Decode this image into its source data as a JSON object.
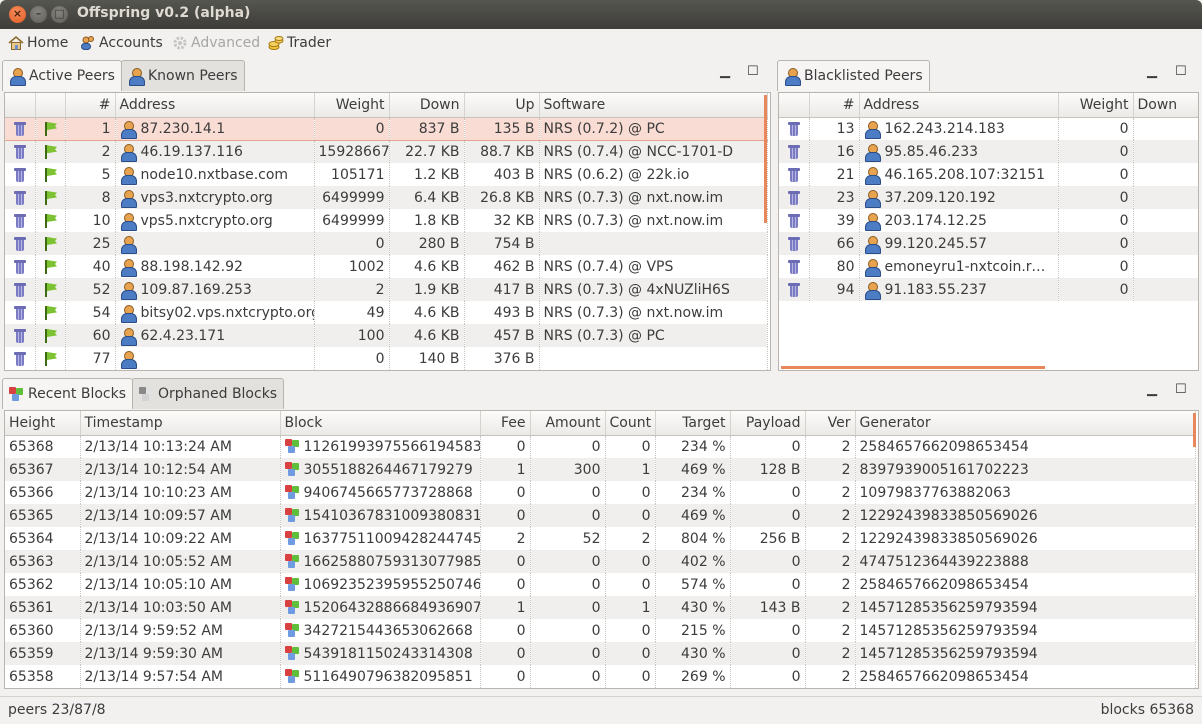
{
  "window": {
    "title": "Offspring v0.2 (alpha)"
  },
  "menu": {
    "home": "Home",
    "accounts": "Accounts",
    "advanced": "Advanced",
    "trader": "Trader"
  },
  "peers_tabs": {
    "active": "Active Peers",
    "known": "Known Peers"
  },
  "blacklist_tabs": {
    "blacklisted": "Blacklisted Peers"
  },
  "blocks_tabs": {
    "recent": "Recent Blocks",
    "orphaned": "Orphaned Blocks"
  },
  "panel_controls": {
    "minimize": "▁",
    "maximize": "☐"
  },
  "peers_table": {
    "columns": [
      "#",
      "Address",
      "Weight",
      "Down",
      "Up",
      "Software"
    ],
    "rows": [
      [
        "1",
        "87.230.14.1",
        "0",
        "837 B",
        "135 B",
        "NRS (0.7.2) @ PC"
      ],
      [
        "2",
        "46.19.137.116",
        "15928667",
        "22.7 KB",
        "88.7 KB",
        "NRS (0.7.4) @ NCC-1701-D"
      ],
      [
        "5",
        "node10.nxtbase.com",
        "105171",
        "1.2 KB",
        "403 B",
        "NRS (0.6.2) @ 22k.io"
      ],
      [
        "8",
        "vps3.nxtcrypto.org",
        "6499999",
        "6.4 KB",
        "26.8 KB",
        "NRS (0.7.3) @ nxt.now.im"
      ],
      [
        "10",
        "vps5.nxtcrypto.org",
        "6499999",
        "1.8 KB",
        "32 KB",
        "NRS (0.7.3) @ nxt.now.im"
      ],
      [
        "25",
        "",
        "0",
        "280 B",
        "754 B",
        ""
      ],
      [
        "40",
        "88.198.142.92",
        "1002",
        "4.6 KB",
        "462 B",
        "NRS (0.7.4) @ VPS"
      ],
      [
        "52",
        "109.87.169.253",
        "2",
        "1.9 KB",
        "417 B",
        "NRS (0.7.3) @ 4xNUZliH6S"
      ],
      [
        "54",
        "bitsy02.vps.nxtcrypto.org",
        "49",
        "4.6 KB",
        "493 B",
        "NRS (0.7.3) @ nxt.now.im"
      ],
      [
        "60",
        "62.4.23.171",
        "100",
        "4.6 KB",
        "457 B",
        "NRS (0.7.3) @ PC"
      ],
      [
        "77",
        "",
        "0",
        "140 B",
        "376 B",
        ""
      ]
    ]
  },
  "blacklist_table": {
    "columns": [
      "#",
      "Address",
      "Weight",
      "Down"
    ],
    "rows": [
      [
        "13",
        "162.243.214.183",
        "0"
      ],
      [
        "16",
        "95.85.46.233",
        "0"
      ],
      [
        "21",
        "46.165.208.107:32151",
        "0"
      ],
      [
        "23",
        "37.209.120.192",
        "0"
      ],
      [
        "39",
        "203.174.12.25",
        "0"
      ],
      [
        "66",
        "99.120.245.57",
        "0"
      ],
      [
        "80",
        "emoneyru1-nxtcoin.rhcl...",
        "0"
      ],
      [
        "94",
        "91.183.55.237",
        "0"
      ]
    ]
  },
  "blocks_table": {
    "columns": [
      "Height",
      "Timestamp",
      "Block",
      "Fee",
      "Amount",
      "Count",
      "Target",
      "Payload",
      "Ver",
      "Generator"
    ],
    "rows": [
      [
        "65368",
        "2/13/14 10:13:24 AM",
        "11261993975566194583",
        "0",
        "0",
        "0",
        "234 %",
        "0",
        "2",
        "2584657662098653454"
      ],
      [
        "65367",
        "2/13/14 10:12:54 AM",
        "3055188264467179279",
        "1",
        "300",
        "1",
        "469 %",
        "128 B",
        "2",
        "8397939005161702223"
      ],
      [
        "65366",
        "2/13/14 10:10:23 AM",
        "9406745665773728868",
        "0",
        "0",
        "0",
        "234 %",
        "0",
        "2",
        "10979837763882063"
      ],
      [
        "65365",
        "2/13/14 10:09:57 AM",
        "15410367831009380831",
        "0",
        "0",
        "0",
        "469 %",
        "0",
        "2",
        "12292439833850569026"
      ],
      [
        "65364",
        "2/13/14 10:09:22 AM",
        "16377511009428244745",
        "2",
        "52",
        "2",
        "804 %",
        "256 B",
        "2",
        "12292439833850569026"
      ],
      [
        "65363",
        "2/13/14 10:05:52 AM",
        "16625880759313077985",
        "0",
        "0",
        "0",
        "402 %",
        "0",
        "2",
        "4747512364439223888"
      ],
      [
        "65362",
        "2/13/14 10:05:10 AM",
        "10692352395955250746",
        "0",
        "0",
        "0",
        "574 %",
        "0",
        "2",
        "2584657662098653454"
      ],
      [
        "65361",
        "2/13/14 10:03:50 AM",
        "15206432886684936907",
        "1",
        "0",
        "1",
        "430 %",
        "143 B",
        "2",
        "14571285356259793594"
      ],
      [
        "65360",
        "2/13/14 9:59:52 AM",
        "3427215443653062668",
        "0",
        "0",
        "0",
        "215 %",
        "0",
        "2",
        "14571285356259793594"
      ],
      [
        "65359",
        "2/13/14 9:59:30 AM",
        "5439181150243314308",
        "0",
        "0",
        "0",
        "430 %",
        "0",
        "2",
        "14571285356259793594"
      ],
      [
        "65358",
        "2/13/14 9:57:54 AM",
        "5116490796382095851",
        "0",
        "0",
        "0",
        "269 %",
        "0",
        "2",
        "2584657662098653454"
      ]
    ]
  },
  "status": {
    "left": "peers 23/87/8",
    "right": "blocks 65368"
  },
  "colors": {
    "accent": "#e8865c",
    "selection": "#f9dcd3",
    "titlebar": "#3d3c38"
  }
}
